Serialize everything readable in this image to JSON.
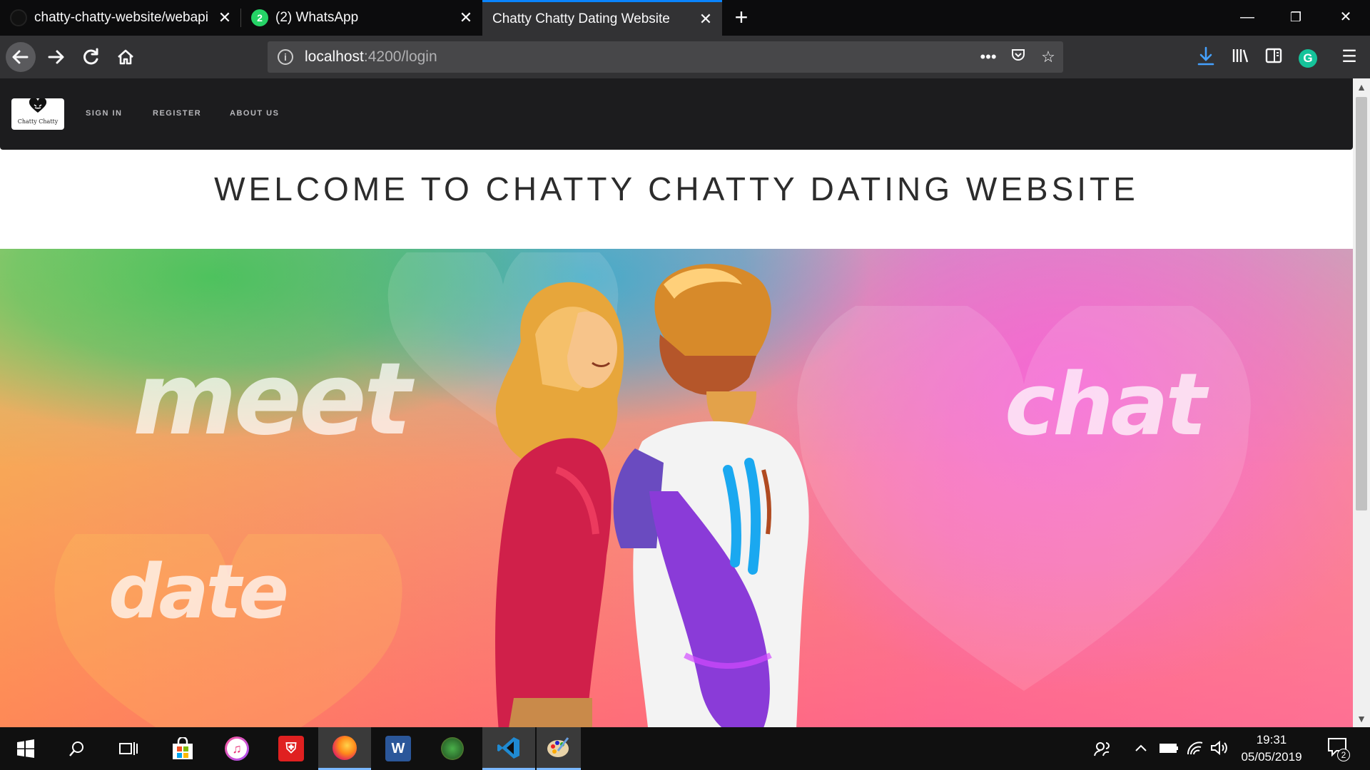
{
  "browser": {
    "tabs": [
      {
        "title": "chatty-chatty-website/webapi",
        "active": false
      },
      {
        "title": "(2) WhatsApp",
        "active": false,
        "badge": "2"
      },
      {
        "title": "Chatty Chatty Dating Website",
        "active": true
      }
    ],
    "url": {
      "host": "localhost",
      "rest": ":4200/login"
    },
    "accent": "#0a84ff"
  },
  "site": {
    "logo_text": "Chatty Chatty",
    "nav": {
      "sign_in": "SIGN IN",
      "register": "REGISTER",
      "about_us": "ABOUT US"
    },
    "heading": "WELCOME TO CHATTY CHATTY DATING WEBSITE",
    "hero": {
      "word_meet": "meet",
      "word_chat": "chat",
      "word_date": "date"
    }
  },
  "taskbar": {
    "apps": [
      "start-icon",
      "search-icon",
      "task-view-icon",
      "store-icon",
      "itunes-icon",
      "shield-app-icon",
      "firefox-icon",
      "word-icon",
      "app-icon",
      "vscode-icon",
      "paint-icon"
    ],
    "active_app": "firefox-icon",
    "time": "19:31",
    "date": "05/05/2019",
    "notification_count": "2"
  }
}
